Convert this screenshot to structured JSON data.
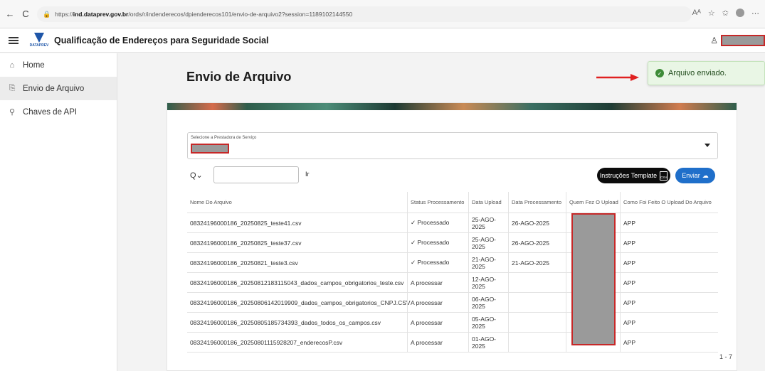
{
  "browser": {
    "url_prefix": "https://",
    "url_host": "ind.dataprev.gov.br",
    "url_path": "/ords/r/indenderecos/dpienderecos101/envio-de-arquivo2?session=1189102144550",
    "back": "←",
    "refresh": "C"
  },
  "header": {
    "logo_text": "DATAPREV",
    "title": "Qualificação de Endereços para Seguridade Social"
  },
  "sidebar": {
    "items": [
      {
        "label": "Home",
        "icon": "home-icon",
        "glyph": "⌂"
      },
      {
        "label": "Envio de Arquivo",
        "icon": "file-upload-icon",
        "glyph": "⎘"
      },
      {
        "label": "Chaves de API",
        "icon": "key-icon",
        "glyph": "⚲"
      }
    ],
    "active_index": 1
  },
  "page": {
    "title": "Envio de Arquivo"
  },
  "toast": {
    "message": "Arquivo enviado.",
    "status_color": "#3d8b37"
  },
  "form": {
    "select_label": "Selecione a Prestadora de Serviço"
  },
  "toolbar": {
    "search_icon": "Q⌄",
    "search_value": "",
    "go_label": "Ir",
    "template_label": "Instruções Template",
    "csv_icon_text": "CSV",
    "send_label": "Enviar"
  },
  "table": {
    "headers": [
      "Nome Do Arquivo",
      "Status Processamento",
      "Data Upload",
      "Data Processamento",
      "Quem Fez O Upload",
      "Como Foi Feito O Upload Do Arquivo"
    ],
    "rows": [
      [
        "08324196000186_20250825_teste41.csv",
        "✓ Processado",
        "25-AGO-2025",
        "26-AGO-2025",
        "",
        "APP"
      ],
      [
        "08324196000186_20250825_teste37.csv",
        "✓ Processado",
        "25-AGO-2025",
        "26-AGO-2025",
        "",
        "APP"
      ],
      [
        "08324196000186_20250821_teste3.csv",
        "✓ Processado",
        "21-AGO-2025",
        "21-AGO-2025",
        "",
        "APP"
      ],
      [
        "08324196000186_20250812183115043_dados_campos_obrigatorios_teste.csv",
        "A processar",
        "12-AGO-2025",
        "",
        "",
        "APP"
      ],
      [
        "08324196000186_20250806142019909_dados_campos_obrigatorios_CNPJ.CSV",
        "A processar",
        "06-AGO-2025",
        "",
        "",
        "APP"
      ],
      [
        "08324196000186_20250805185734393_dados_todos_os_campos.csv",
        "A processar",
        "05-AGO-2025",
        "",
        "",
        "APP"
      ],
      [
        "08324196000186_20250801115928207_enderecosP.csv",
        "A processar",
        "01-AGO-2025",
        "",
        "",
        "APP"
      ]
    ],
    "pagination": "1 - 7"
  },
  "colors": {
    "accent_blue": "#1f6fca",
    "redaction_border": "#c62828",
    "arrow_red": "#e02020"
  }
}
